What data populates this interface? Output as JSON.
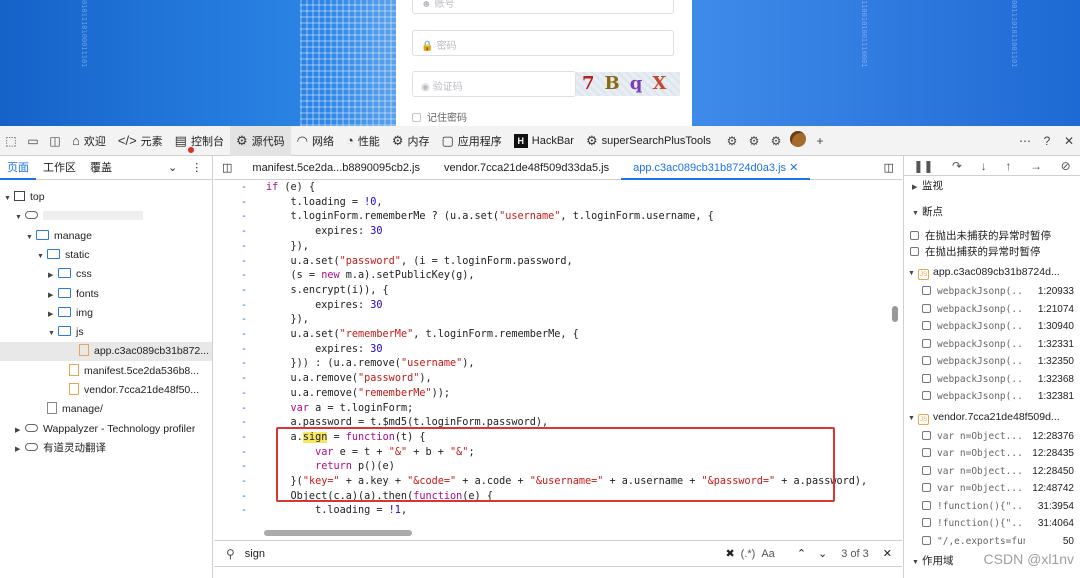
{
  "login": {
    "account_placeholder": "账号",
    "password_placeholder": "密码",
    "captcha_placeholder": "验证码",
    "captcha_chars": [
      "7",
      "B",
      "q",
      "X"
    ],
    "remember_label": "记住密码"
  },
  "toolbar": {
    "tabs": [
      {
        "icon": "home-icon",
        "label": "欢迎"
      },
      {
        "icon": "code-icon",
        "label": "元素"
      },
      {
        "icon": "console-icon",
        "label": "控制台"
      },
      {
        "icon": "bug-icon",
        "label": "源代码",
        "active": true
      },
      {
        "icon": "wifi-icon",
        "label": "网络"
      },
      {
        "icon": "gauge-icon",
        "label": "性能"
      },
      {
        "icon": "gear-icon",
        "label": "内存"
      },
      {
        "icon": "app-icon",
        "label": "应用程序"
      },
      {
        "icon": "hackbar-icon",
        "label": "HackBar"
      },
      {
        "icon": "extension-icon",
        "label": "superSearchPlusTools"
      }
    ]
  },
  "navigator": {
    "tabs": [
      "页面",
      "工作区",
      "覆盖"
    ],
    "tree": [
      {
        "label": "top",
        "kind": "frame",
        "depth": 0,
        "arrow": "down"
      },
      {
        "label": "",
        "kind": "cloud",
        "depth": 1,
        "arrow": "down"
      },
      {
        "label": "manage",
        "kind": "folder",
        "depth": 2,
        "arrow": "down"
      },
      {
        "label": "static",
        "kind": "folder",
        "depth": 3,
        "arrow": "down"
      },
      {
        "label": "css",
        "kind": "folder",
        "depth": 4,
        "arrow": "right"
      },
      {
        "label": "fonts",
        "kind": "folder",
        "depth": 4,
        "arrow": "right"
      },
      {
        "label": "img",
        "kind": "folder",
        "depth": 4,
        "arrow": "right"
      },
      {
        "label": "js",
        "kind": "folder",
        "depth": 4,
        "arrow": "down"
      },
      {
        "label": "app.c3ac089cb31b872...",
        "kind": "file",
        "depth": 5,
        "selected": true
      },
      {
        "label": "manifest.5ce2da536b8...",
        "kind": "file",
        "depth": 5
      },
      {
        "label": "vendor.7cca21de48f50...",
        "kind": "file",
        "depth": 5
      },
      {
        "label": "manage/",
        "kind": "filegray",
        "depth": 3
      },
      {
        "label": "Wappalyzer - Technology profiler",
        "kind": "cloud",
        "depth": 1,
        "arrow": "right"
      },
      {
        "label": "有道灵动翻译",
        "kind": "cloud",
        "depth": 1,
        "arrow": "right"
      }
    ]
  },
  "editor": {
    "tabs": [
      {
        "label": "manifest.5ce2da...b8890095cb2.js"
      },
      {
        "label": "vendor.7cca21de48f509d33da5.js"
      },
      {
        "label": "app.c3ac089cb31b8724d0a3.js",
        "active": true
      }
    ],
    "lines": [
      "if (e) {",
      "    t.loading = !0,",
      "    t.loginForm.rememberMe ? (u.a.set(\"username\", t.loginForm.username, {",
      "        expires: 30",
      "    }),",
      "    u.a.set(\"password\", (i = t.loginForm.password,",
      "    (s = new m.a).setPublicKey(g),",
      "    s.encrypt(i)), {",
      "        expires: 30",
      "    }),",
      "    u.a.set(\"rememberMe\", t.loginForm.rememberMe, {",
      "        expires: 30",
      "    })) : (u.a.remove(\"username\"),",
      "    u.a.remove(\"password\"),",
      "    u.a.remove(\"rememberMe\"));",
      "    var a = t.loginForm;",
      "    a.password = t.$md5(t.loginForm.password),",
      "    a.sign = function(t) {",
      "        var e = t + \"&\" + b + \"&\";",
      "        return p()(e)",
      "    }(\"key=\" + a.key + \"&code=\" + a.code + \"&username=\" + a.username + \"&password=\" + a.password),",
      "    Object(c.a)(a).then(function(e) {",
      "        t.loading = !1,"
    ],
    "gutter": "-"
  },
  "search": {
    "query": "sign",
    "regex_label": "(.*)",
    "case_label": "Aa",
    "count": "3 of 3"
  },
  "debugger": {
    "watch_label": "监视",
    "breakpoints_label": "断点",
    "pause_uncaught": "在抛出未捕获的异常时暂停",
    "pause_caught": "在抛出捕获的异常时暂停",
    "groups": [
      {
        "file": "app.c3ac089cb31b8724d...",
        "items": [
          {
            "code": "webpackJsonp(...",
            "loc": "1:20933"
          },
          {
            "code": "webpackJsonp(...",
            "loc": "1:21074"
          },
          {
            "code": "webpackJsonp(...",
            "loc": "1:30940"
          },
          {
            "code": "webpackJsonp(...",
            "loc": "1:32331"
          },
          {
            "code": "webpackJsonp(...",
            "loc": "1:32350"
          },
          {
            "code": "webpackJsonp(...",
            "loc": "1:32368"
          },
          {
            "code": "webpackJsonp(...",
            "loc": "1:32381"
          }
        ]
      },
      {
        "file": "vendor.7cca21de48f509d...",
        "items": [
          {
            "code": "var n=Object...",
            "loc": "12:28376"
          },
          {
            "code": "var n=Object...",
            "loc": "12:28435"
          },
          {
            "code": "var n=Object...",
            "loc": "12:28450"
          },
          {
            "code": "var n=Object...",
            "loc": "12:48742"
          },
          {
            "code": "!function(){\"...",
            "loc": "31:3954"
          },
          {
            "code": "!function(){\"...",
            "loc": "31:4064"
          },
          {
            "code": "\"/,e.exports=funct...",
            "loc": "50"
          }
        ]
      }
    ],
    "scope_label": "作用域"
  },
  "watermark": "CSDN @xl1nv"
}
